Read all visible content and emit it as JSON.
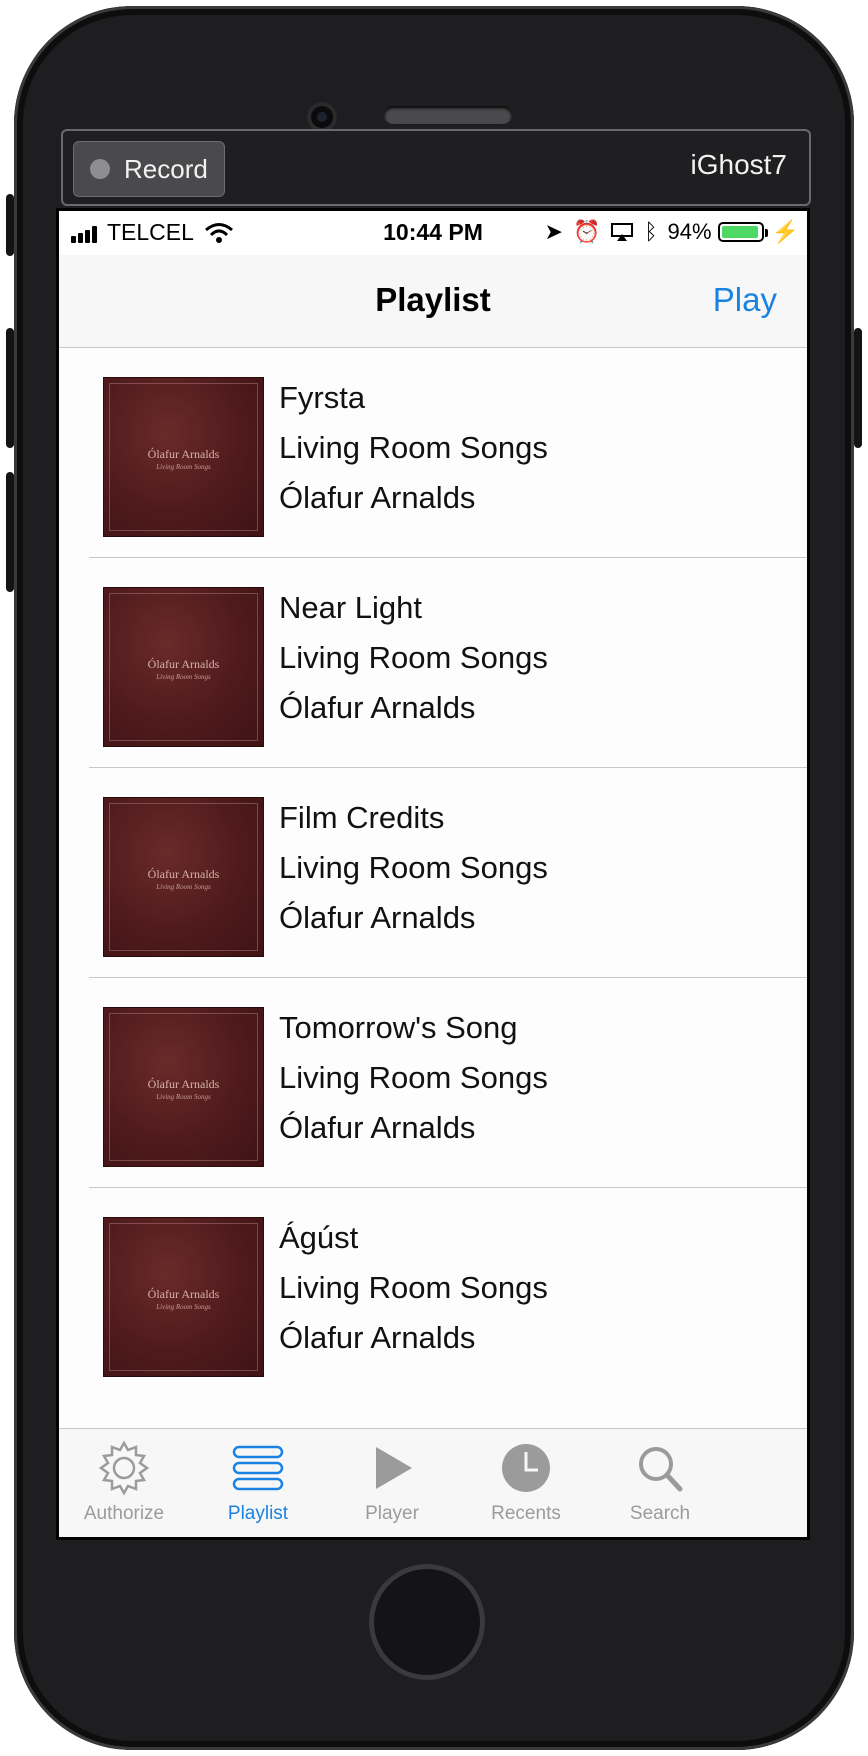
{
  "device": {
    "record_label": "Record",
    "name": "iGhost7"
  },
  "status": {
    "carrier": "TELCEL",
    "time": "10:44 PM",
    "battery": "94%",
    "battery_level": 0.94
  },
  "nav": {
    "title": "Playlist",
    "action": "Play"
  },
  "tracks": [
    {
      "title": "Fyrsta",
      "album": "Living Room Songs",
      "artist": "Ólafur Arnalds"
    },
    {
      "title": "Near Light",
      "album": "Living Room Songs",
      "artist": "Ólafur Arnalds"
    },
    {
      "title": "Film Credits",
      "album": "Living Room Songs",
      "artist": "Ólafur Arnalds"
    },
    {
      "title": "Tomorrow's Song",
      "album": "Living Room Songs",
      "artist": "Ólafur Arnalds"
    },
    {
      "title": "Ágúst",
      "album": "Living Room Songs",
      "artist": "Ólafur Arnalds"
    }
  ],
  "cover_art": {
    "artist": "Ólafur Arnalds",
    "album": "Living Room Songs"
  },
  "tabs": [
    {
      "label": "Authorize",
      "icon": "gear-icon"
    },
    {
      "label": "Playlist",
      "icon": "list-icon",
      "active": true
    },
    {
      "label": "Player",
      "icon": "play-icon"
    },
    {
      "label": "Recents",
      "icon": "clock-icon"
    },
    {
      "label": "Search",
      "icon": "search-icon"
    }
  ],
  "colors": {
    "accent": "#1a82e2",
    "inactive": "#9b9b9b",
    "cover": "#4f1a1c",
    "battery": "#4cd964"
  }
}
